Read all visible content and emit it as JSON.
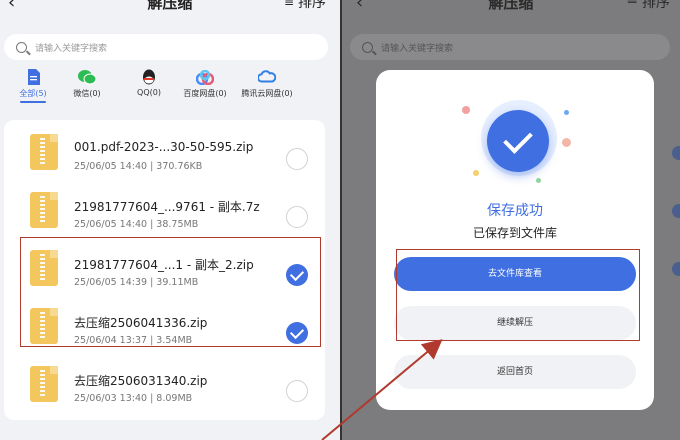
{
  "header": {
    "title": "解压缩",
    "back_glyph": "‹",
    "sort_label": "排序",
    "sort_icon": "≡"
  },
  "search": {
    "placeholder": "请输入关键字搜索"
  },
  "categories": [
    {
      "label": "全部(5)",
      "icon": "file-icon",
      "color": "#3f6fe0"
    },
    {
      "label": "微信(0)",
      "icon": "wechat-icon",
      "color": "#2dbb54"
    },
    {
      "label": "QQ(0)",
      "icon": "qq-icon",
      "color": "#222222"
    },
    {
      "label": "百度网盘(0)",
      "icon": "baidu-netdisk-icon",
      "color": "#4a8df6"
    },
    {
      "label": "腾讯云网盘(0)",
      "icon": "tencent-cloud-icon",
      "color": "#2f7fe6"
    }
  ],
  "files": [
    {
      "name": "001.pdf-2023-...30-50-595.zip",
      "meta": "25/06/05 14:40 | 370.76KB",
      "selected": false
    },
    {
      "name": "21981777604_...9761 - 副本.7z",
      "meta": "25/06/05 14:40 | 38.75MB",
      "selected": false
    },
    {
      "name": "21981777604_...1 - 副本_2.zip",
      "meta": "25/06/05 14:39 | 39.11MB",
      "selected": true
    },
    {
      "name": "去压缩2506041336.zip",
      "meta": "25/06/04 13:37 | 3.54MB",
      "selected": true
    },
    {
      "name": "去压缩2506031340.zip",
      "meta": "25/06/03 13:40 | 8.09MB",
      "selected": false
    }
  ],
  "modal": {
    "title": "保存成功",
    "subtitle": "已保存到文件库",
    "primary_button": "去文件库查看",
    "continue_button": "继续解压",
    "home_button": "返回首页"
  },
  "colors": {
    "accent": "#3f6fe0",
    "highlight_border": "#b03a2e",
    "overlay": "#7c7c7e"
  }
}
